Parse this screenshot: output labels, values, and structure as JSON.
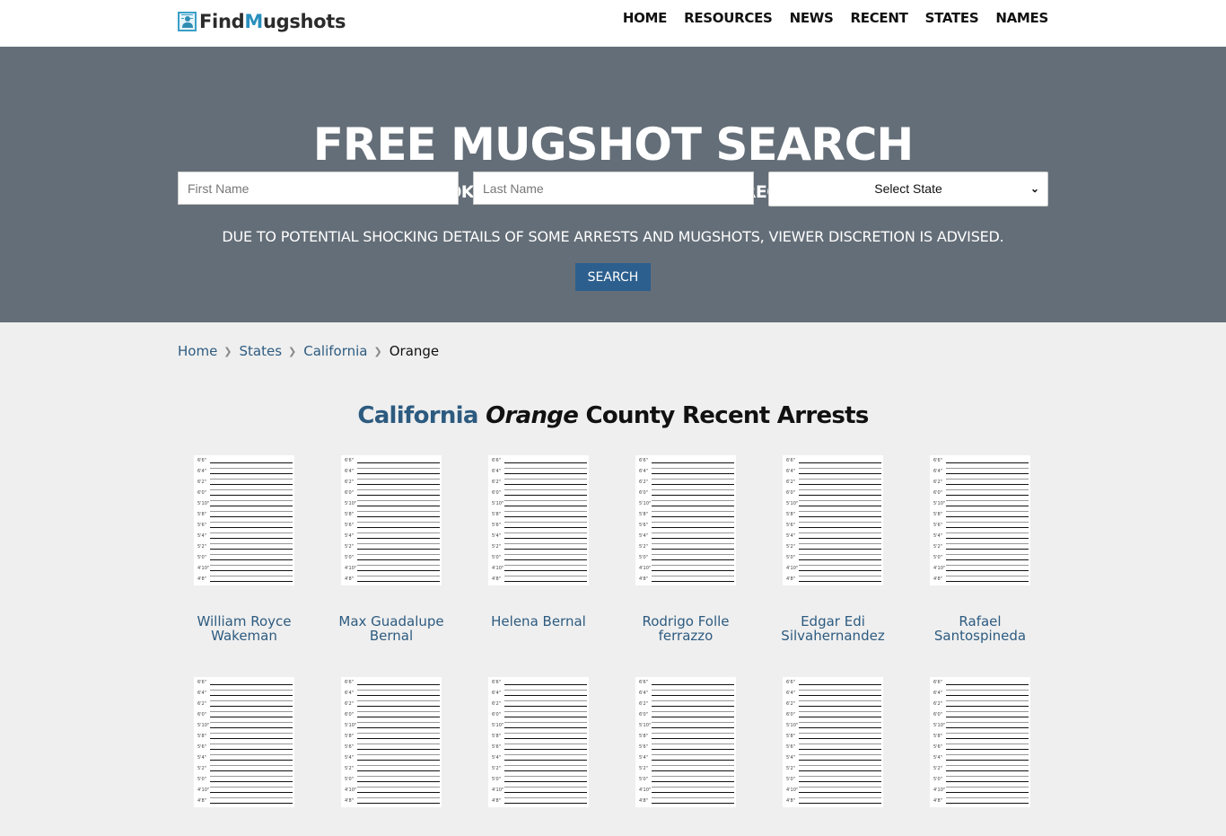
{
  "header": {
    "logo": {
      "text_prefix": "Find",
      "text_highlight": "M",
      "text_suffix": "ugshots",
      "icon": "mugshot-id-card-icon"
    },
    "nav": [
      {
        "label": "HOME"
      },
      {
        "label": "RESOURCES"
      },
      {
        "label": "NEWS"
      },
      {
        "label": "RECENT"
      },
      {
        "label": "STATES"
      },
      {
        "label": "NAMES"
      }
    ]
  },
  "hero": {
    "title": "FREE MUGSHOT SEARCH",
    "subtitle": "INSTANTLY LOOKUP MUG SHOTS AND ARREST RECORDS IN USA!",
    "first_name": {
      "value": "",
      "placeholder": "First Name"
    },
    "last_name": {
      "value": "",
      "placeholder": "Last Name"
    },
    "state_select": {
      "selected": "Select State",
      "icon": "chevron-down-icon"
    },
    "notice": "DUE TO POTENTIAL SHOCKING DETAILS OF SOME ARRESTS AND MUGSHOTS, VIEWER DISCRETION IS ADVISED.",
    "search_label": "SEARCH"
  },
  "breadcrumb": {
    "items": [
      {
        "label": "Home"
      },
      {
        "label": "States"
      },
      {
        "label": "California"
      }
    ],
    "current": "Orange",
    "separator_icon": "chevron-right-icon"
  },
  "section": {
    "state": "California",
    "county": "Orange",
    "rest": "County Recent Arrests"
  },
  "height_chart_labels": [
    "6'6\"",
    "6'4\"",
    "6'2\"",
    "6'0\"",
    "5'10\"",
    "5'8\"",
    "5'6\"",
    "5'4\"",
    "5'2\"",
    "5'0\"",
    "4'10\"",
    "4'8\""
  ],
  "arrests": [
    {
      "name": "William Royce Wakeman"
    },
    {
      "name": "Max Guadalupe Bernal"
    },
    {
      "name": "Helena Bernal"
    },
    {
      "name": "Rodrigo Folle ferrazzo"
    },
    {
      "name": "Edgar Edi Silvahernandez"
    },
    {
      "name": "Rafael Santospineda"
    },
    {
      "name": ""
    },
    {
      "name": ""
    },
    {
      "name": ""
    },
    {
      "name": ""
    },
    {
      "name": ""
    },
    {
      "name": ""
    }
  ]
}
